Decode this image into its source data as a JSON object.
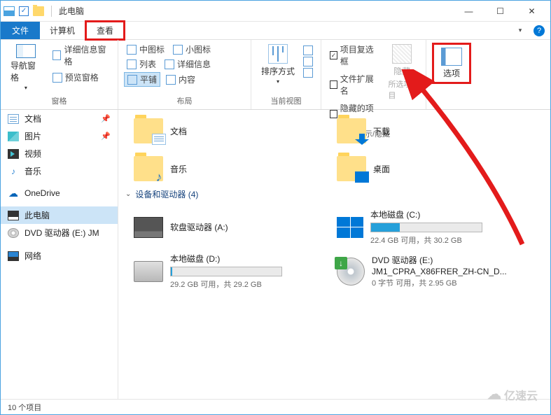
{
  "window": {
    "title": "此电脑"
  },
  "tabs": {
    "file": "文件",
    "computer": "计算机",
    "view": "查看"
  },
  "ribbon": {
    "panes": {
      "navPane": "导航窗格",
      "previewPane": "预览窗格",
      "detailsPane": "详细信息窗格",
      "groupLabel": "窗格"
    },
    "layout": {
      "medIcons": "中图标",
      "smallIcons": "小图标",
      "list": "列表",
      "details": "详细信息",
      "tiles": "平铺",
      "content": "内容",
      "groupLabel": "布局"
    },
    "view": {
      "sortBy": "排序方式",
      "groupLabel": "当前视图"
    },
    "showhide": {
      "itemCheck": "项目复选框",
      "fileExt": "文件扩展名",
      "hiddenItems": "隐藏的项目",
      "hide": "隐藏",
      "hideSelected": "所选项目",
      "groupLabel": "显示/隐藏"
    },
    "options": {
      "label": "选项"
    }
  },
  "sidebar": {
    "items": [
      {
        "label": "文档",
        "icon": "ic-doc",
        "pinned": true
      },
      {
        "label": "图片",
        "icon": "ic-pic",
        "pinned": true
      },
      {
        "label": "视频",
        "icon": "ic-vid",
        "pinned": false
      },
      {
        "label": "音乐",
        "icon": "ic-music",
        "pinned": false
      },
      {
        "label": "OneDrive",
        "icon": "ic-onedrive",
        "pinned": false
      },
      {
        "label": "此电脑",
        "icon": "ic-pc",
        "pinned": false,
        "selected": true
      },
      {
        "label": "DVD 驱动器 (E:) JM",
        "icon": "ic-dvd",
        "pinned": false
      },
      {
        "label": "网络",
        "icon": "ic-net",
        "pinned": false
      }
    ]
  },
  "main": {
    "foldersRow1": [
      {
        "label": "文档",
        "overlay": "ov-doc"
      },
      {
        "label": "下载",
        "overlay": "ov-dl"
      }
    ],
    "foldersRow2": [
      {
        "label": "音乐",
        "overlay": "ov-music"
      },
      {
        "label": "桌面",
        "overlay": "ov-desk"
      }
    ],
    "devicesHeader": "设备和驱动器 (4)",
    "drives": {
      "floppy": {
        "title": "软盘驱动器 (A:)"
      },
      "c": {
        "title": "本地磁盘 (C:)",
        "usageText": "22.4 GB 可用，共 30.2 GB",
        "usagePct": 26
      },
      "d": {
        "title": "本地磁盘 (D:)",
        "usageText": "29.2 GB 可用，共 29.2 GB",
        "usagePct": 1
      },
      "dvd": {
        "title": "DVD 驱动器 (E:)",
        "sub": "JM1_CPRA_X86FRER_ZH-CN_D...",
        "usageText": "0 字节 可用，共 2.95 GB"
      }
    }
  },
  "status": {
    "text": "10 个项目"
  },
  "watermark": "亿速云"
}
